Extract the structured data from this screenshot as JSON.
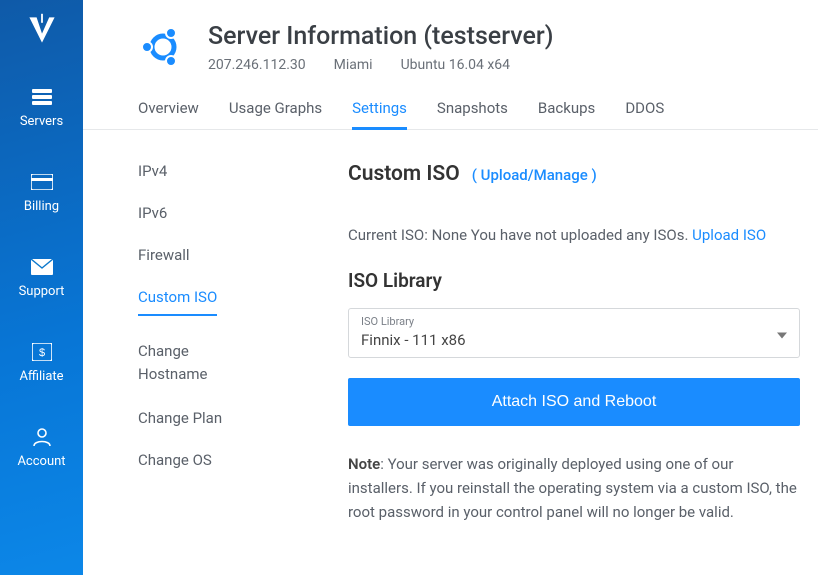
{
  "sidebar": {
    "items": [
      {
        "label": "Servers"
      },
      {
        "label": "Billing"
      },
      {
        "label": "Support"
      },
      {
        "label": "Affiliate"
      },
      {
        "label": "Account"
      }
    ]
  },
  "header": {
    "title": "Server Information (testserver)",
    "ip": "207.246.112.30",
    "location": "Miami",
    "os": "Ubuntu 16.04 x64"
  },
  "tabs": [
    {
      "label": "Overview"
    },
    {
      "label": "Usage Graphs"
    },
    {
      "label": "Settings"
    },
    {
      "label": "Snapshots"
    },
    {
      "label": "Backups"
    },
    {
      "label": "DDOS"
    }
  ],
  "settings_nav": [
    {
      "label": "IPv4"
    },
    {
      "label": "IPv6"
    },
    {
      "label": "Firewall"
    },
    {
      "label": "Custom ISO"
    },
    {
      "label": "Change Hostname"
    },
    {
      "label": "Change Plan"
    },
    {
      "label": "Change OS"
    }
  ],
  "panel": {
    "heading": "Custom ISO",
    "heading_link": "( Upload/Manage )",
    "current_iso_prefix": "Current ISO: None You have not uploaded any ISOs. ",
    "current_iso_link": "Upload ISO",
    "library_heading": "ISO Library",
    "select_label": "ISO Library",
    "select_value": "Finnix - 111 x86",
    "button": "Attach ISO and Reboot",
    "note_label": "Note",
    "note_text": ": Your server was originally deployed using one of our installers. If you reinstall the operating system via a custom ISO, the root password in your control panel will no longer be valid."
  },
  "colors": {
    "accent": "#1a8cff"
  }
}
